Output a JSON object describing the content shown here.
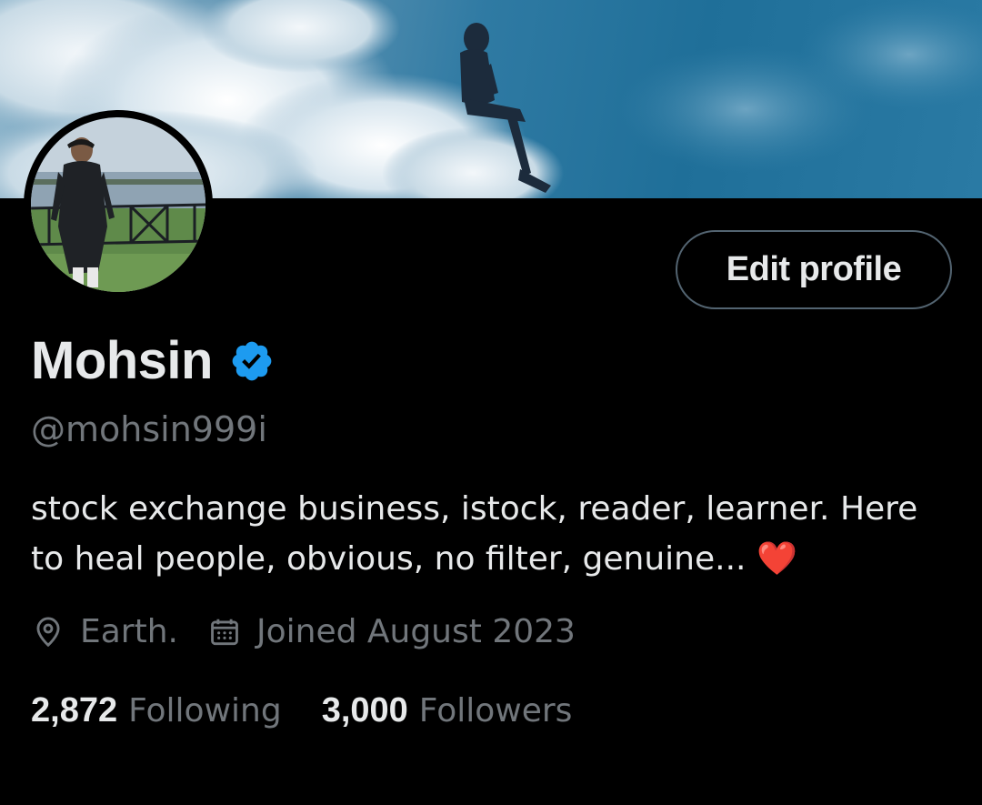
{
  "profile": {
    "name": "Mohsin",
    "handle": "@mohsin999i",
    "bio_text": "stock exchange business, istock, reader, learner. Here to heal people, obvious, no filter, genuine...",
    "bio_emoji": "❤️",
    "location": "Earth.",
    "joined": "Joined August 2023"
  },
  "actions": {
    "edit_profile_label": "Edit profile"
  },
  "stats": {
    "following_count": "2,872",
    "following_label": "Following",
    "followers_count": "3,000",
    "followers_label": "Followers"
  },
  "icons": {
    "verified": "verified-badge-icon",
    "location": "location-pin-icon",
    "calendar": "calendar-icon"
  },
  "colors": {
    "background": "#000000",
    "primary_text": "#e7e9ea",
    "secondary_text": "#71767b",
    "verified_blue": "#1d9bf0",
    "heart_red": "#f4212e"
  }
}
